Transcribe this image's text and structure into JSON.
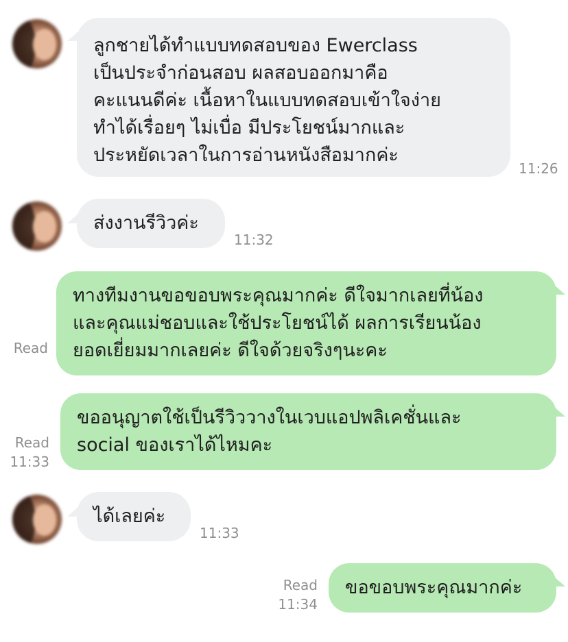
{
  "messages": [
    {
      "side": "incoming",
      "lines": [
        "ลูกชายได้ทำแบบทดสอบของ Ewerclass",
        "เป็นประจำก่อนสอบ ผลสอบออกมาคือ",
        "คะแนนดีค่ะ เนื้อหาในแบบทดสอบเข้าใจง่าย",
        "ทำได้เรื่อยๆ ไม่เบื่อ มีประโยชน์มากและ",
        "ประหยัดเวลาในการอ่านหนังสือมากค่ะ"
      ],
      "time": "11:26"
    },
    {
      "side": "incoming",
      "lines": [
        "ส่งงานรีวิวค่ะ"
      ],
      "time": "11:32"
    },
    {
      "side": "outgoing",
      "lines": [
        "ทางทีมงานขอขอบพระคุณมากค่ะ ดีใจมากเลยที่น้อง",
        "และคุณแม่ชอบและใช้ประโยชน์ได้ ผลการเรียนน้อง",
        "ยอดเยี่ยมมากเลยค่ะ ดีใจด้วยจริงๆนะคะ"
      ],
      "read": "Read",
      "time": ""
    },
    {
      "side": "outgoing",
      "lines": [
        "ขออนุญาตใช้เป็นรีวิววางในเวบแอปพลิเคชั่นและ",
        "social ของเราได้ไหมคะ"
      ],
      "read": "Read",
      "time": "11:33"
    },
    {
      "side": "incoming",
      "lines": [
        "ได้เลยค่ะ"
      ],
      "time": "11:33"
    },
    {
      "side": "outgoing",
      "lines": [
        "ขอขอบพระคุณมากค่ะ"
      ],
      "read": "Read",
      "time": "11:34"
    }
  ],
  "colors": {
    "incoming_bubble": "#eeeff1",
    "outgoing_bubble": "#b7e9b5",
    "meta_text": "#8f8f8f"
  },
  "icons": {
    "avatar": "contact-avatar-photo"
  }
}
